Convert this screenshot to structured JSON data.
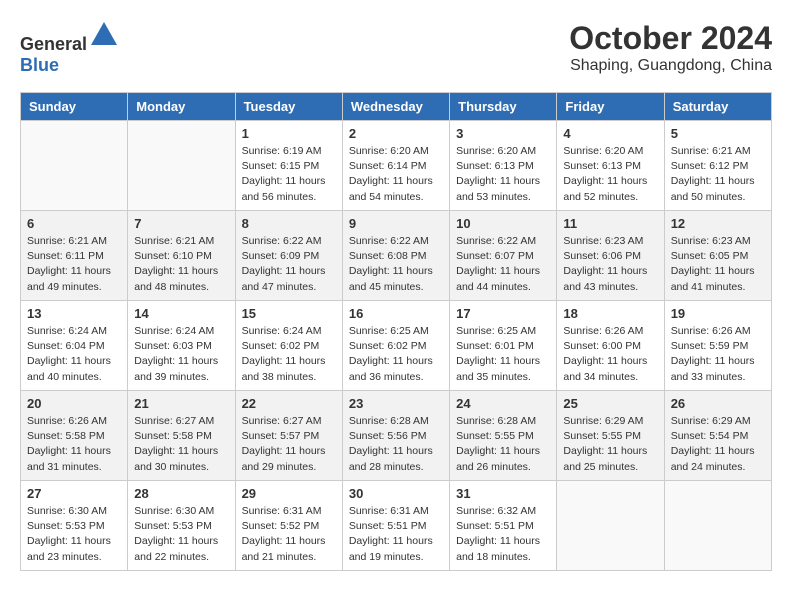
{
  "logo": {
    "general": "General",
    "blue": "Blue"
  },
  "title": "October 2024",
  "location": "Shaping, Guangdong, China",
  "weekdays": [
    "Sunday",
    "Monday",
    "Tuesday",
    "Wednesday",
    "Thursday",
    "Friday",
    "Saturday"
  ],
  "weeks": [
    [
      {
        "day": "",
        "sunrise": "",
        "sunset": "",
        "daylight": ""
      },
      {
        "day": "",
        "sunrise": "",
        "sunset": "",
        "daylight": ""
      },
      {
        "day": "1",
        "sunrise": "Sunrise: 6:19 AM",
        "sunset": "Sunset: 6:15 PM",
        "daylight": "Daylight: 11 hours and 56 minutes."
      },
      {
        "day": "2",
        "sunrise": "Sunrise: 6:20 AM",
        "sunset": "Sunset: 6:14 PM",
        "daylight": "Daylight: 11 hours and 54 minutes."
      },
      {
        "day": "3",
        "sunrise": "Sunrise: 6:20 AM",
        "sunset": "Sunset: 6:13 PM",
        "daylight": "Daylight: 11 hours and 53 minutes."
      },
      {
        "day": "4",
        "sunrise": "Sunrise: 6:20 AM",
        "sunset": "Sunset: 6:13 PM",
        "daylight": "Daylight: 11 hours and 52 minutes."
      },
      {
        "day": "5",
        "sunrise": "Sunrise: 6:21 AM",
        "sunset": "Sunset: 6:12 PM",
        "daylight": "Daylight: 11 hours and 50 minutes."
      }
    ],
    [
      {
        "day": "6",
        "sunrise": "Sunrise: 6:21 AM",
        "sunset": "Sunset: 6:11 PM",
        "daylight": "Daylight: 11 hours and 49 minutes."
      },
      {
        "day": "7",
        "sunrise": "Sunrise: 6:21 AM",
        "sunset": "Sunset: 6:10 PM",
        "daylight": "Daylight: 11 hours and 48 minutes."
      },
      {
        "day": "8",
        "sunrise": "Sunrise: 6:22 AM",
        "sunset": "Sunset: 6:09 PM",
        "daylight": "Daylight: 11 hours and 47 minutes."
      },
      {
        "day": "9",
        "sunrise": "Sunrise: 6:22 AM",
        "sunset": "Sunset: 6:08 PM",
        "daylight": "Daylight: 11 hours and 45 minutes."
      },
      {
        "day": "10",
        "sunrise": "Sunrise: 6:22 AM",
        "sunset": "Sunset: 6:07 PM",
        "daylight": "Daylight: 11 hours and 44 minutes."
      },
      {
        "day": "11",
        "sunrise": "Sunrise: 6:23 AM",
        "sunset": "Sunset: 6:06 PM",
        "daylight": "Daylight: 11 hours and 43 minutes."
      },
      {
        "day": "12",
        "sunrise": "Sunrise: 6:23 AM",
        "sunset": "Sunset: 6:05 PM",
        "daylight": "Daylight: 11 hours and 41 minutes."
      }
    ],
    [
      {
        "day": "13",
        "sunrise": "Sunrise: 6:24 AM",
        "sunset": "Sunset: 6:04 PM",
        "daylight": "Daylight: 11 hours and 40 minutes."
      },
      {
        "day": "14",
        "sunrise": "Sunrise: 6:24 AM",
        "sunset": "Sunset: 6:03 PM",
        "daylight": "Daylight: 11 hours and 39 minutes."
      },
      {
        "day": "15",
        "sunrise": "Sunrise: 6:24 AM",
        "sunset": "Sunset: 6:02 PM",
        "daylight": "Daylight: 11 hours and 38 minutes."
      },
      {
        "day": "16",
        "sunrise": "Sunrise: 6:25 AM",
        "sunset": "Sunset: 6:02 PM",
        "daylight": "Daylight: 11 hours and 36 minutes."
      },
      {
        "day": "17",
        "sunrise": "Sunrise: 6:25 AM",
        "sunset": "Sunset: 6:01 PM",
        "daylight": "Daylight: 11 hours and 35 minutes."
      },
      {
        "day": "18",
        "sunrise": "Sunrise: 6:26 AM",
        "sunset": "Sunset: 6:00 PM",
        "daylight": "Daylight: 11 hours and 34 minutes."
      },
      {
        "day": "19",
        "sunrise": "Sunrise: 6:26 AM",
        "sunset": "Sunset: 5:59 PM",
        "daylight": "Daylight: 11 hours and 33 minutes."
      }
    ],
    [
      {
        "day": "20",
        "sunrise": "Sunrise: 6:26 AM",
        "sunset": "Sunset: 5:58 PM",
        "daylight": "Daylight: 11 hours and 31 minutes."
      },
      {
        "day": "21",
        "sunrise": "Sunrise: 6:27 AM",
        "sunset": "Sunset: 5:58 PM",
        "daylight": "Daylight: 11 hours and 30 minutes."
      },
      {
        "day": "22",
        "sunrise": "Sunrise: 6:27 AM",
        "sunset": "Sunset: 5:57 PM",
        "daylight": "Daylight: 11 hours and 29 minutes."
      },
      {
        "day": "23",
        "sunrise": "Sunrise: 6:28 AM",
        "sunset": "Sunset: 5:56 PM",
        "daylight": "Daylight: 11 hours and 28 minutes."
      },
      {
        "day": "24",
        "sunrise": "Sunrise: 6:28 AM",
        "sunset": "Sunset: 5:55 PM",
        "daylight": "Daylight: 11 hours and 26 minutes."
      },
      {
        "day": "25",
        "sunrise": "Sunrise: 6:29 AM",
        "sunset": "Sunset: 5:55 PM",
        "daylight": "Daylight: 11 hours and 25 minutes."
      },
      {
        "day": "26",
        "sunrise": "Sunrise: 6:29 AM",
        "sunset": "Sunset: 5:54 PM",
        "daylight": "Daylight: 11 hours and 24 minutes."
      }
    ],
    [
      {
        "day": "27",
        "sunrise": "Sunrise: 6:30 AM",
        "sunset": "Sunset: 5:53 PM",
        "daylight": "Daylight: 11 hours and 23 minutes."
      },
      {
        "day": "28",
        "sunrise": "Sunrise: 6:30 AM",
        "sunset": "Sunset: 5:53 PM",
        "daylight": "Daylight: 11 hours and 22 minutes."
      },
      {
        "day": "29",
        "sunrise": "Sunrise: 6:31 AM",
        "sunset": "Sunset: 5:52 PM",
        "daylight": "Daylight: 11 hours and 21 minutes."
      },
      {
        "day": "30",
        "sunrise": "Sunrise: 6:31 AM",
        "sunset": "Sunset: 5:51 PM",
        "daylight": "Daylight: 11 hours and 19 minutes."
      },
      {
        "day": "31",
        "sunrise": "Sunrise: 6:32 AM",
        "sunset": "Sunset: 5:51 PM",
        "daylight": "Daylight: 11 hours and 18 minutes."
      },
      {
        "day": "",
        "sunrise": "",
        "sunset": "",
        "daylight": ""
      },
      {
        "day": "",
        "sunrise": "",
        "sunset": "",
        "daylight": ""
      }
    ]
  ]
}
